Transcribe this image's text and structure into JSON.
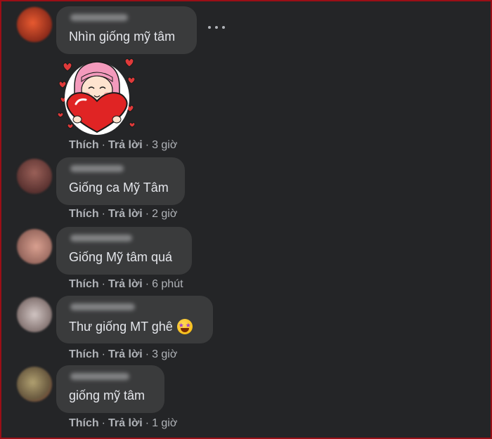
{
  "comments": [
    {
      "text": "Nhìn giống mỹ tâm",
      "like": "Thích",
      "reply": "Trả lời",
      "time": "3 giờ",
      "avatar_color": "#c0432a",
      "has_sticker": true,
      "sticker_icon": "girl-hugging-heart-sticker"
    },
    {
      "text": "Giống ca Mỹ Tâm",
      "like": "Thích",
      "reply": "Trả lời",
      "time": "2 giờ",
      "avatar_color": "#7a4a45"
    },
    {
      "text": "Giống Mỹ tâm quá",
      "like": "Thích",
      "reply": "Trả lời",
      "time": "6 phút",
      "avatar_color": "#b07a70"
    },
    {
      "text": "Thư giống MT ghê",
      "emoji": "star-struck-emoji",
      "like": "Thích",
      "reply": "Trả lời",
      "time": "3 giờ",
      "avatar_color": "#a89a98"
    },
    {
      "text": "giống mỹ tâm",
      "like": "Thích",
      "reply": "Trả lời",
      "time": "1 giờ",
      "avatar_color": "#8a7a60"
    }
  ],
  "colors": {
    "background": "#242527",
    "bubble": "#3a3b3c",
    "text": "#e4e6eb",
    "muted": "#b0b3b8",
    "frame": "#9b0e16"
  }
}
